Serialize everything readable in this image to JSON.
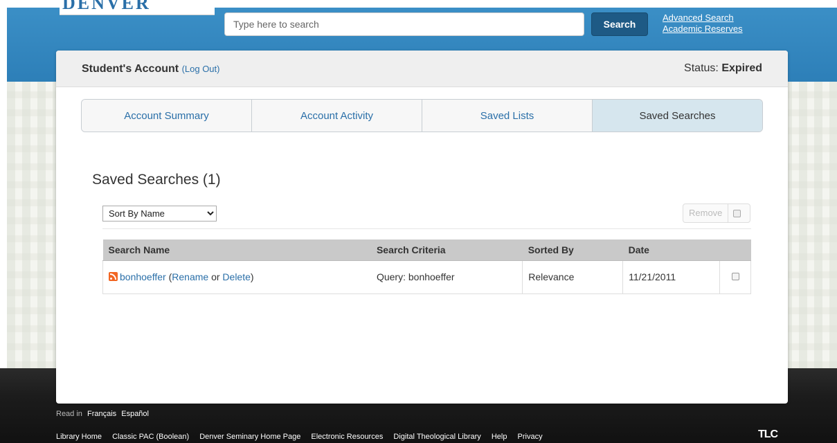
{
  "header": {
    "search_placeholder": "Type here to search",
    "search_button": "Search",
    "advanced_search": "Advanced Search",
    "academic_reserves": "Academic Reserves"
  },
  "account": {
    "title": "Student's Account",
    "logout": "(Log Out)",
    "status_label": "Status:",
    "status_value": "Expired"
  },
  "tabs": [
    {
      "label": "Account Summary",
      "active": false
    },
    {
      "label": "Account Activity",
      "active": false
    },
    {
      "label": "Saved Lists",
      "active": false
    },
    {
      "label": "Saved Searches",
      "active": true
    }
  ],
  "saved_searches": {
    "title": "Saved Searches (1)",
    "sort_selected": "Sort By Name",
    "remove_label": "Remove",
    "columns": [
      "Search Name",
      "Search Criteria",
      "Sorted By",
      "Date"
    ],
    "rows": [
      {
        "name": "bonhoeffer",
        "open_paren": "(",
        "rename": "Rename",
        "or": "or",
        "delete": "Delete",
        "close_paren": ")",
        "criteria": "Query: bonhoeffer",
        "sorted_by": "Relevance",
        "date": "11/21/2011"
      }
    ]
  },
  "footer": {
    "read_in": "Read in",
    "languages": [
      "Français",
      "Español"
    ],
    "links": [
      "Library Home",
      "Classic PAC (Boolean)",
      "Denver Seminary Home Page",
      "Electronic Resources",
      "Digital Theological Library",
      "Help",
      "Privacy"
    ],
    "brand": "TLC"
  },
  "colors": {
    "header_blue": "#3b8fc6",
    "link_blue": "#2a6fa8",
    "search_button": "#1e5a85",
    "active_tab": "#d6e6ee",
    "rss_orange": "#f26522"
  }
}
